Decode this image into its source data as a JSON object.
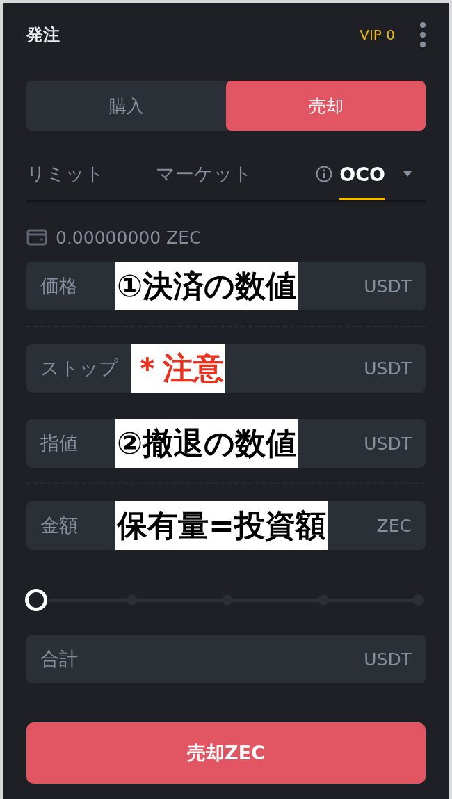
{
  "header": {
    "title": "発注",
    "vip": "VIP 0"
  },
  "sides": [
    {
      "label": "購入",
      "selected": false
    },
    {
      "label": "売却",
      "selected": true
    }
  ],
  "order_types": [
    {
      "label": "リミット",
      "selected": false,
      "info": false,
      "dropdown": false
    },
    {
      "label": "マーケット",
      "selected": false,
      "info": false,
      "dropdown": false
    },
    {
      "label": "OCO",
      "selected": true,
      "info": true,
      "dropdown": true
    }
  ],
  "balance": "0.00000000 ZEC",
  "fields": [
    {
      "label": "価格",
      "unit": "USDT",
      "annotation": {
        "text": "①決済の数値",
        "color": "#000000"
      },
      "divider_after": true
    },
    {
      "label": "ストップ",
      "unit": "USDT",
      "annotation": {
        "text": "＊注意",
        "color": "#e8321e"
      },
      "divider_after": false
    },
    {
      "label": "指値",
      "unit": "USDT",
      "annotation": {
        "text": "②撤退の数値",
        "color": "#000000"
      },
      "divider_after": true
    },
    {
      "label": "金額",
      "unit": "ZEC",
      "annotation": {
        "text": "保有量=投資額",
        "color": "#000000"
      },
      "divider_after": false
    }
  ],
  "slider": {
    "level": 0
  },
  "total": {
    "label": "合計",
    "unit": "USDT"
  },
  "submit": "売却ZEC"
}
